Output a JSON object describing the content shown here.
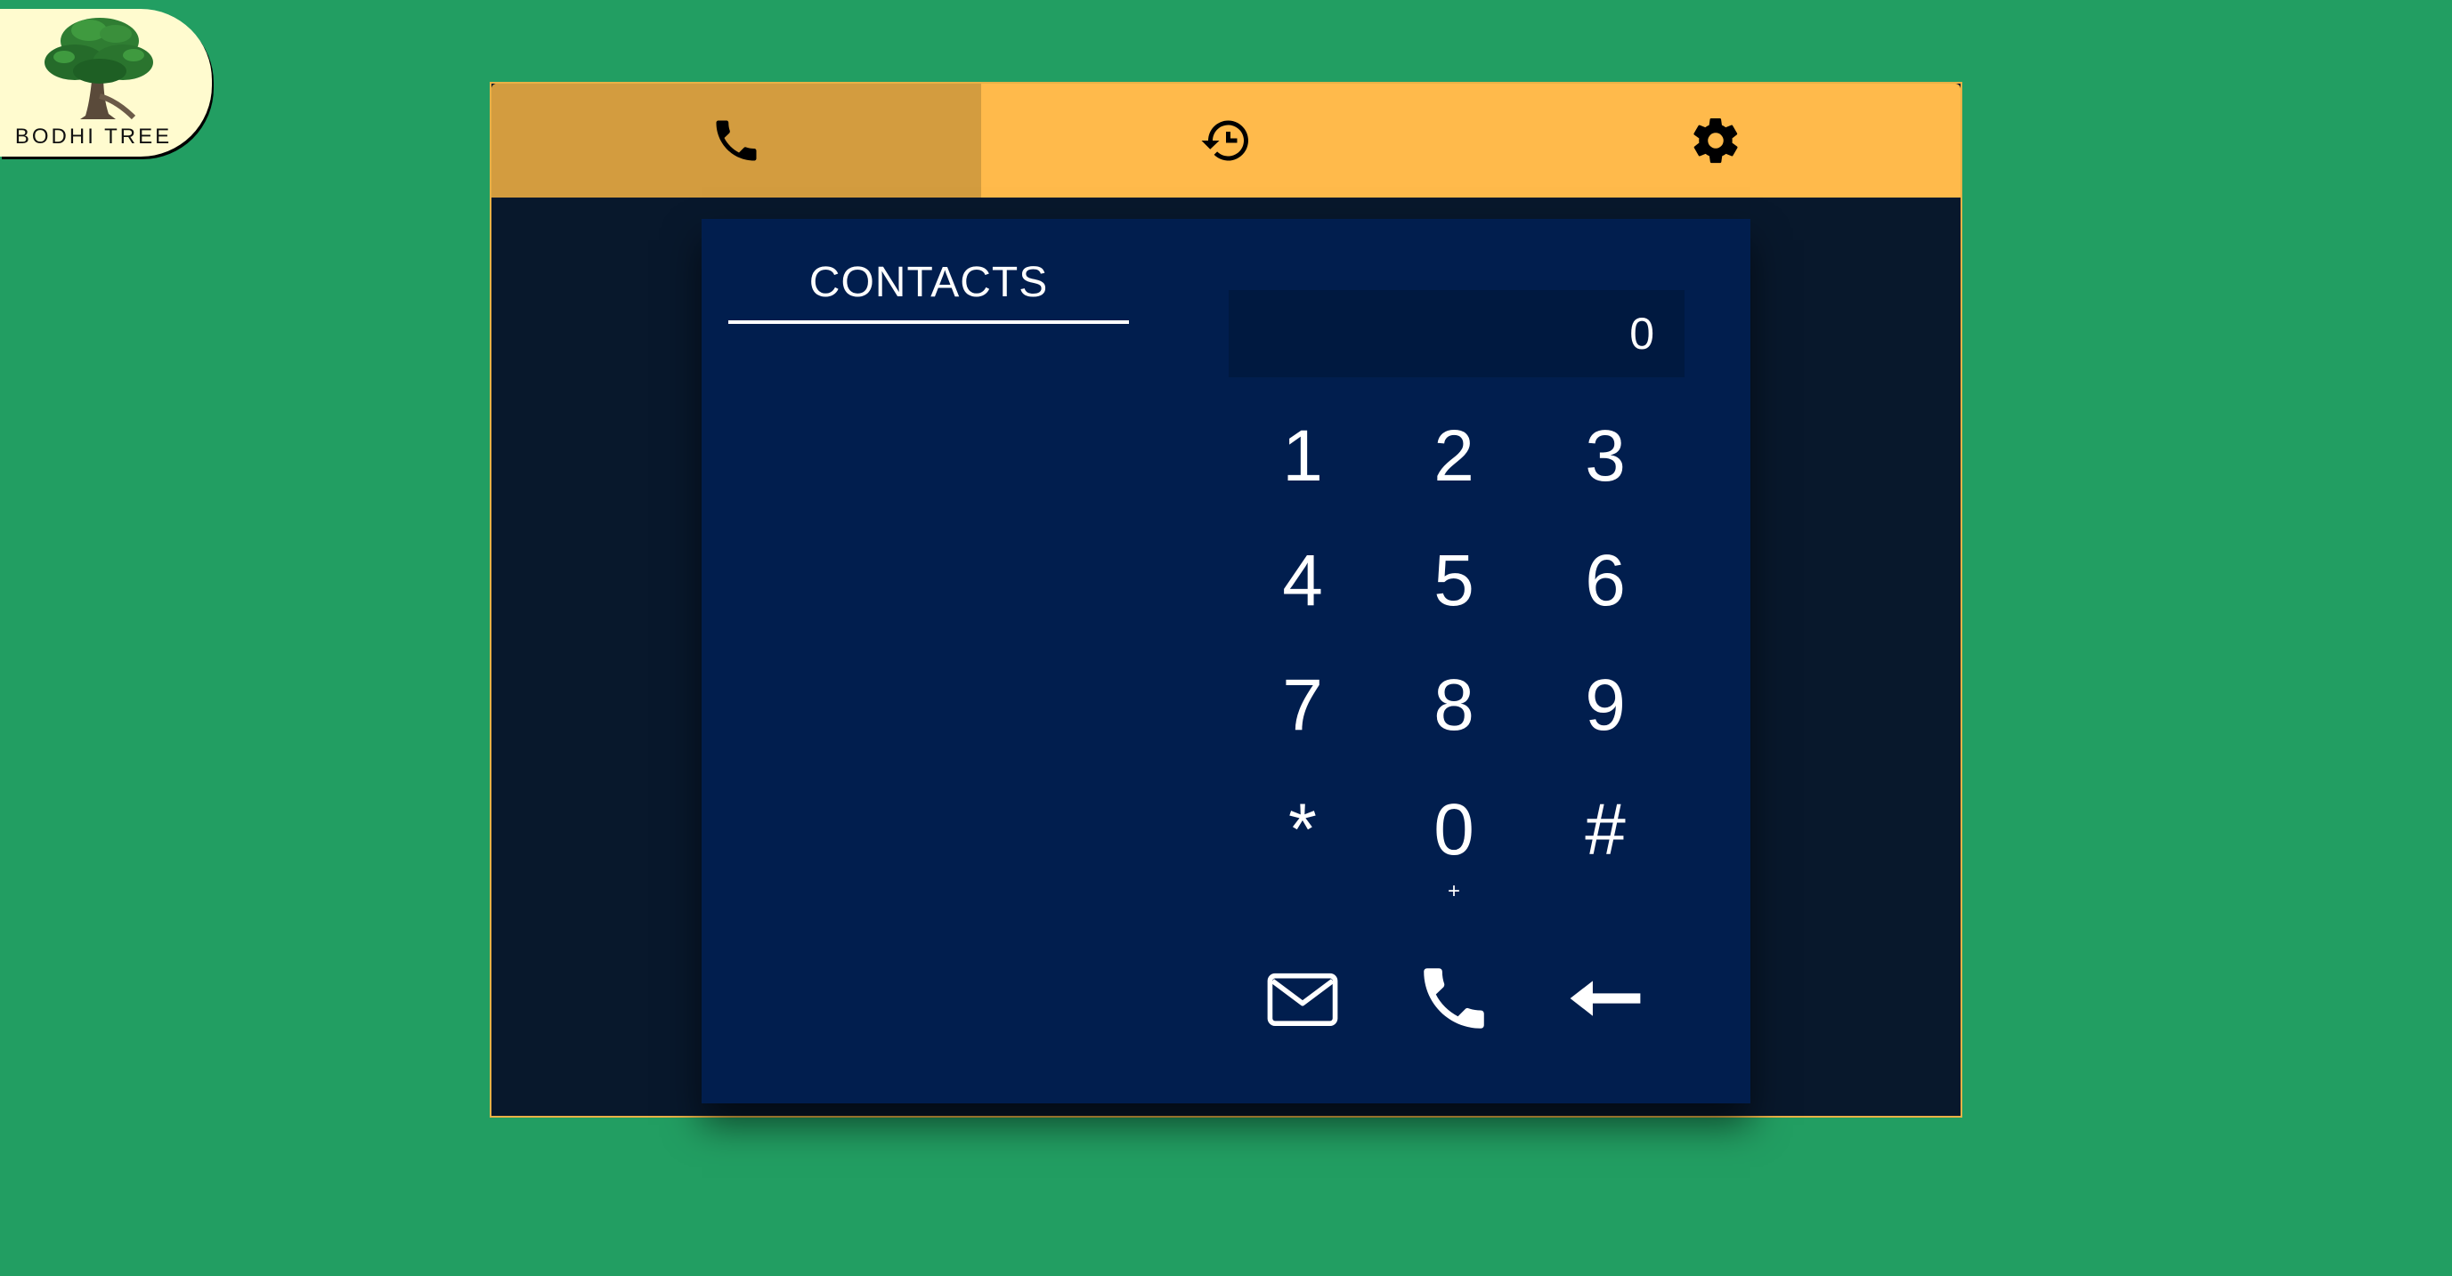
{
  "logo": {
    "text": "BODHI TREE"
  },
  "tabs": [
    {
      "icon": "phone-icon",
      "active": true
    },
    {
      "icon": "history-icon",
      "active": false
    },
    {
      "icon": "gear-icon",
      "active": false
    }
  ],
  "contacts": {
    "title": "CONTACTS"
  },
  "dialer": {
    "display_value": "0",
    "keys": [
      {
        "digit": "1",
        "sub": ""
      },
      {
        "digit": "2",
        "sub": ""
      },
      {
        "digit": "3",
        "sub": ""
      },
      {
        "digit": "4",
        "sub": ""
      },
      {
        "digit": "5",
        "sub": ""
      },
      {
        "digit": "6",
        "sub": ""
      },
      {
        "digit": "7",
        "sub": ""
      },
      {
        "digit": "8",
        "sub": ""
      },
      {
        "digit": "9",
        "sub": ""
      },
      {
        "digit": "*",
        "sub": ""
      },
      {
        "digit": "0",
        "sub": "+"
      },
      {
        "digit": "#",
        "sub": ""
      }
    ],
    "actions": [
      {
        "icon": "envelope-icon"
      },
      {
        "icon": "phone-icon"
      },
      {
        "icon": "backspace-arrow-icon"
      }
    ]
  },
  "colors": {
    "background": "#229e62",
    "tabbar": "#ffba4b",
    "tab_active": "#d39c3f",
    "panel": "#011e4e",
    "window": "#08182c"
  }
}
